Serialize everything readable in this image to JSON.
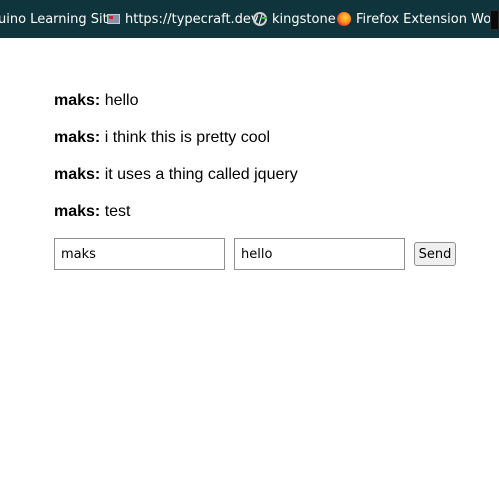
{
  "bookmarks": {
    "items": [
      {
        "label": "uino Learning Site",
        "icon": "none"
      },
      {
        "label": "https://typecraft.dev/",
        "icon": "site-icon"
      },
      {
        "label": "kingstone",
        "icon": "g-icon"
      },
      {
        "label": "Firefox Extension Wor...",
        "icon": "firefox-icon"
      }
    ],
    "background": "#0f343b"
  },
  "chat": {
    "messages": [
      {
        "user": "maks:",
        "text": "hello"
      },
      {
        "user": "maks:",
        "text": "i think this is pretty cool"
      },
      {
        "user": "maks:",
        "text": "it uses a thing called jquery"
      },
      {
        "user": "maks:",
        "text": "test"
      }
    ]
  },
  "form": {
    "name_value": "maks",
    "message_value": "hello",
    "send_label": "Send"
  }
}
